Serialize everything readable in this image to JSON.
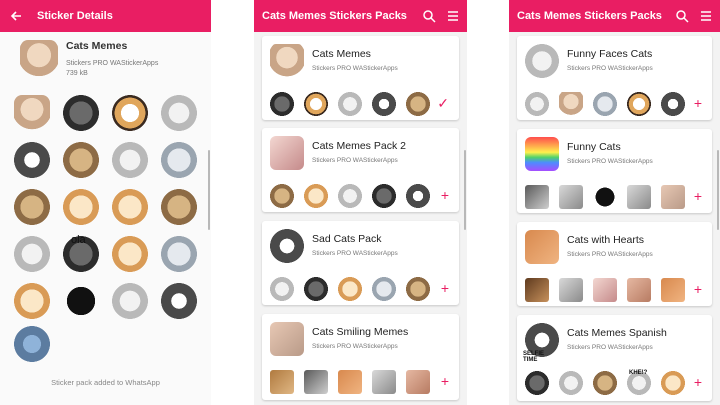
{
  "colors": {
    "accent": "#e91e63",
    "background": "#f3f3f3"
  },
  "details": {
    "title": "Sticker Details",
    "pack_name": "Cats Memes",
    "publisher": "Stickers PRO WAStickerApps",
    "size": "739 kB",
    "ola_text": "ola",
    "footer": "Sticker pack added to WhatsApp"
  },
  "list_middle": {
    "title": "Cats Memes Stickers Packs",
    "packs": [
      {
        "name": "Cats Memes",
        "publisher": "Stickers PRO WAStickerApps",
        "status": "added"
      },
      {
        "name": "Cats Memes Pack 2",
        "publisher": "Stickers PRO WAStickerApps",
        "status": "add"
      },
      {
        "name": "Sad Cats Pack",
        "publisher": "Stickers PRO WAStickerApps",
        "status": "add"
      },
      {
        "name": "Cats Smiling Memes",
        "publisher": "Stickers PRO WAStickerApps",
        "status": "add"
      }
    ]
  },
  "list_right": {
    "title": "Cats Memes Stickers Packs",
    "packs": [
      {
        "name": "Funny Faces Cats",
        "publisher": "Stickers PRO WAStickerApps",
        "status": "add"
      },
      {
        "name": "Funny Cats",
        "publisher": "Stickers PRO WAStickerApps",
        "status": "add"
      },
      {
        "name": "Cats with Hearts",
        "publisher": "Stickers PRO WAStickerApps",
        "status": "add"
      },
      {
        "name": "Cats Memes Spanish",
        "publisher": "Stickers PRO WAStickerApps",
        "status": "add"
      }
    ],
    "selfie_text": "SELFIE TIME",
    "khe_text": "KHE!?"
  },
  "icons": {
    "back": "arrow-back-icon",
    "search": "search-icon",
    "menu": "menu-icon",
    "added": "check-icon",
    "add": "plus-icon"
  },
  "glyphs": {
    "added": "✓",
    "add": "+"
  }
}
